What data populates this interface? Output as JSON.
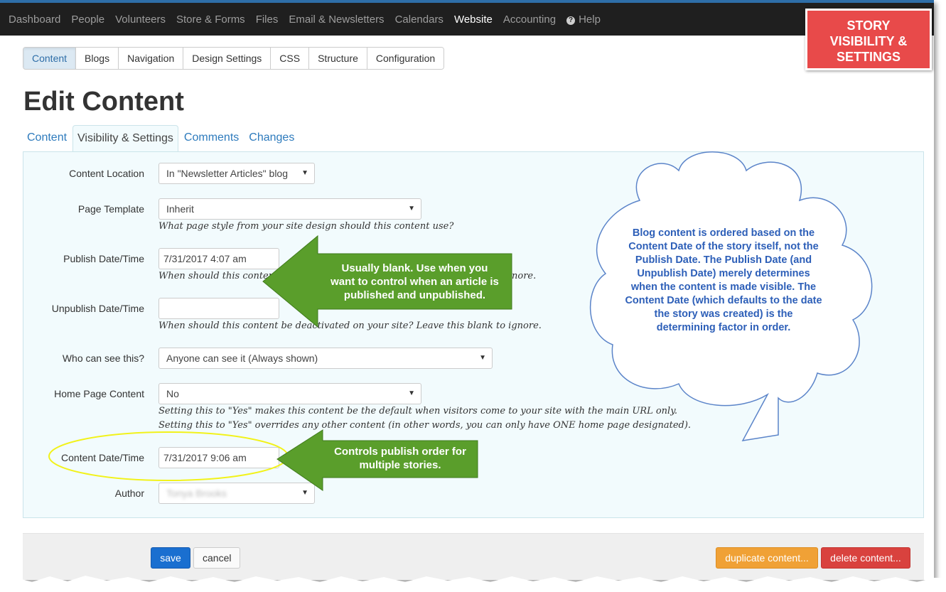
{
  "topnav": {
    "items": [
      "Dashboard",
      "People",
      "Volunteers",
      "Store & Forms",
      "Files",
      "Email & Newsletters",
      "Calendars",
      "Website",
      "Accounting",
      "Help"
    ],
    "active": "Website"
  },
  "badge": {
    "line1": "STORY",
    "line2": "VISIBILITY &",
    "line3": "SETTINGS"
  },
  "section_tabs": [
    "Content",
    "Blogs",
    "Navigation",
    "Design Settings",
    "CSS",
    "Structure",
    "Configuration"
  ],
  "page_title": "Edit Content",
  "inner_tabs": [
    "Content",
    "Visibility & Settings",
    "Comments",
    "Changes"
  ],
  "form": {
    "content_location": {
      "label": "Content Location",
      "value": "In \"Newsletter Articles\" blog"
    },
    "page_template": {
      "label": "Page Template",
      "value": "Inherit",
      "help": "What page style from your site design should this content use?"
    },
    "publish_date": {
      "label": "Publish Date/Time",
      "value": "7/31/2017 4:07 am",
      "help": "When should this content",
      "help_tail": "nore."
    },
    "unpublish_date": {
      "label": "Unpublish Date/Time",
      "value": "",
      "help": "When should this content be deactivated on your site? Leave this blank to ignore."
    },
    "visibility": {
      "label": "Who can see this?",
      "value": "Anyone can see it (Always shown)"
    },
    "home_page": {
      "label": "Home Page Content",
      "value": "No",
      "help1": "Setting this to \"Yes\" makes this content be the default when visitors come to your site with the main URL only.",
      "help2": "Setting this to \"Yes\" overrides any other content (in other words, you can only have ONE home page designated)."
    },
    "content_date": {
      "label": "Content Date/Time",
      "value": "7/31/2017 9:06 am"
    },
    "author": {
      "label": "Author",
      "value": "Tonya Brooks"
    }
  },
  "buttons": {
    "save": "save",
    "cancel": "cancel",
    "duplicate": "duplicate content...",
    "delete": "delete content..."
  },
  "callouts": {
    "publish": [
      "Usually blank. Use when you",
      "want to control when an article is",
      "published and unpublished."
    ],
    "content_date": [
      "Controls publish order for",
      "multiple stories."
    ],
    "cloud": [
      "Blog content is ordered based on the",
      "Content Date of the story itself, not the",
      "Publish Date.  The Publish Date (and",
      "Unpublish Date) merely determines",
      "when the content is made visible.  The",
      "Content Date (which defaults to the date",
      "the story was created) is the",
      "determining factor in order."
    ]
  },
  "colors": {
    "accent": "#2e7bbd",
    "badge": "#e84a4a",
    "arrow": "#5a9e2b",
    "cloud_text": "#2d5fb8",
    "highlight_ellipse": "#f2f21a"
  }
}
